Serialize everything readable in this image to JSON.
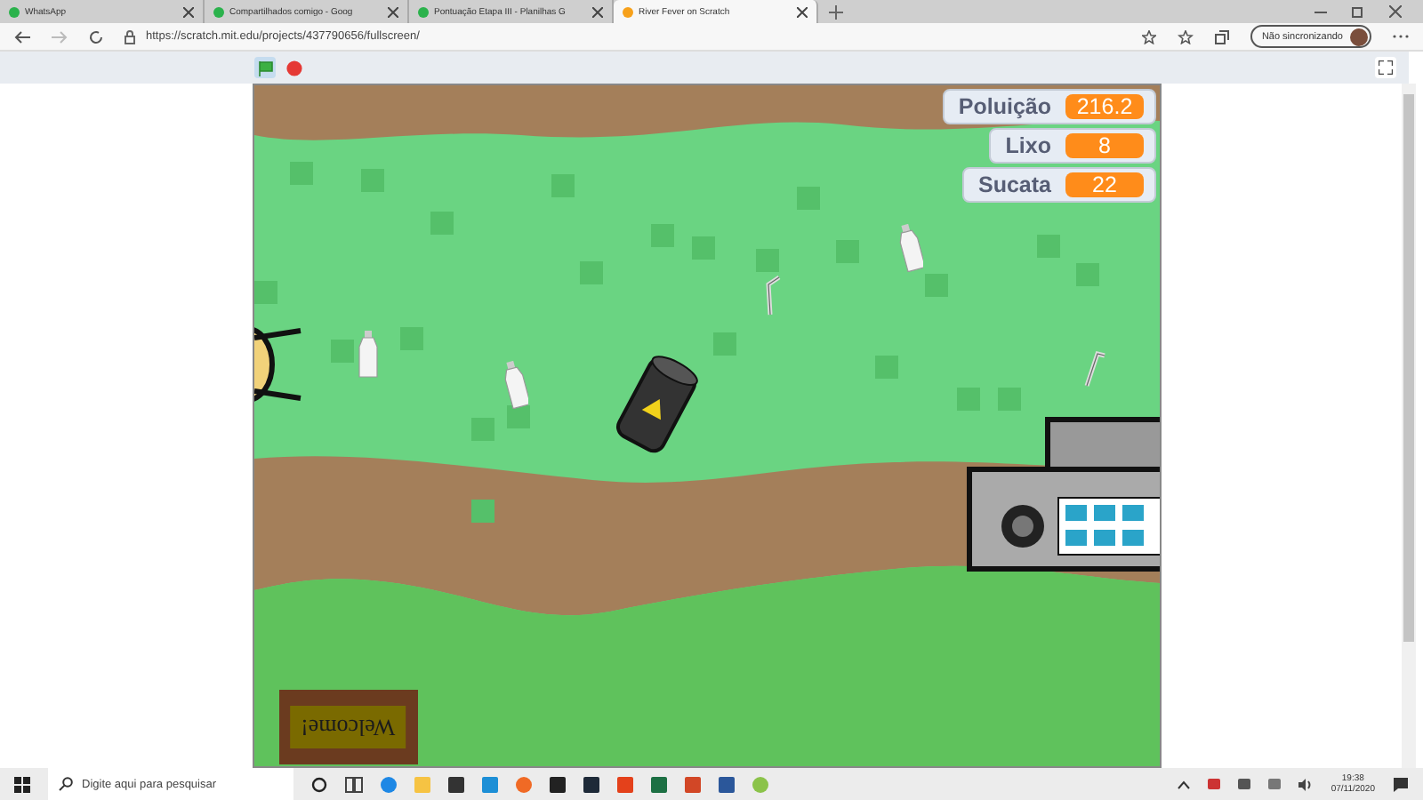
{
  "tabs": [
    {
      "label": "WhatsApp",
      "selected": false
    },
    {
      "label": "Compartilhados comigo - Goog",
      "selected": false
    },
    {
      "label": "Pontuação Etapa III - Planilhas G",
      "selected": false
    },
    {
      "label": "River Fever on Scratch",
      "selected": true
    }
  ],
  "address_bar": {
    "url": "https://scratch.mit.edu/projects/437790656/fullscreen/",
    "profile_label": "Não sincronizando"
  },
  "stage": {
    "monitors": [
      {
        "label": "Poluição",
        "value": "216.2"
      },
      {
        "label": "Lixo",
        "value": "8"
      },
      {
        "label": "Sucata",
        "value": "22"
      }
    ],
    "sign": "Welcome!"
  },
  "taskbar": {
    "search": {
      "placeholder": "Digite aqui para pesquisar"
    },
    "time": "19:38",
    "date": "07/11/2020"
  }
}
